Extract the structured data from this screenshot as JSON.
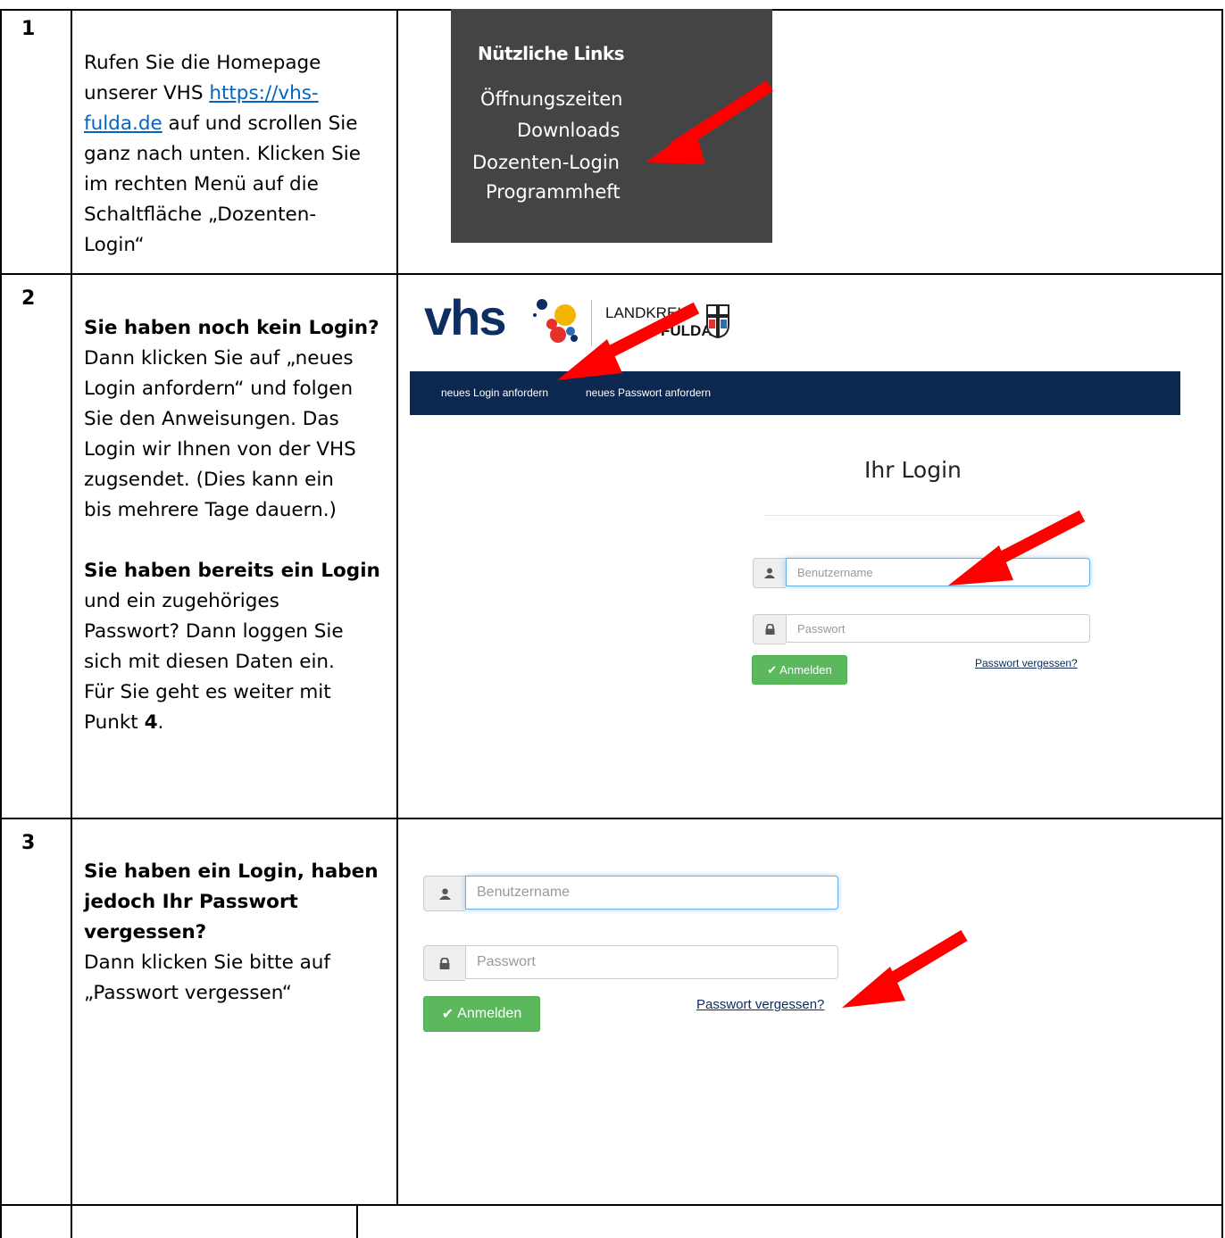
{
  "steps": [
    {
      "number": "1"
    },
    {
      "number": "2"
    },
    {
      "number": "3"
    }
  ],
  "step1": {
    "line1": "Rufen Sie die Homepage",
    "line2_pre": "unserer VHS ",
    "link_part1": "https://vhs-",
    "link_part2": "fulda.de",
    "line3_post": " auf und scrollen Sie",
    "line4": "ganz nach unten. Klicken Sie",
    "line5": "im rechten Menü auf die",
    "line6": "Schaltfläche „Dozenten-",
    "line7": "Login“",
    "panel_title": "Nützliche Links",
    "panel_links": [
      "Öffnungszeiten",
      "Downloads",
      "Dozenten-Login",
      "Programmheft"
    ]
  },
  "step2": {
    "bold1": "Sie haben noch kein Login?",
    "p1": [
      "Dann klicken Sie auf „neues",
      "Login anfordern“ und folgen",
      "Sie den Anweisungen. Das",
      "Login wir Ihnen von der VHS",
      "zugsendet. (Dies kann ein",
      "bis mehrere Tage dauern.)"
    ],
    "bold2": "Sie haben bereits ein Login",
    "p2": [
      "und ein zugehöriges",
      "Passwort? Dann loggen Sie",
      "sich mit diesen Daten ein.",
      "Für Sie geht es weiter mit"
    ],
    "p2_last_pre": "Punkt ",
    "p2_last_bold": "4",
    "p2_last_post": ".",
    "logo_text": "vhs",
    "landkreis": "LANDKREIS",
    "fulda": "FULDA",
    "nav": [
      "neues Login anfordern",
      "neues Passwort anfordern"
    ],
    "login_title": "Ihr Login",
    "username_placeholder": "Benutzername",
    "password_placeholder": "Passwort",
    "button": "Anmelden",
    "forgot": "Passwort vergessen?"
  },
  "step3": {
    "bold": [
      "Sie haben ein Login, haben",
      "jedoch Ihr Passwort",
      "vergessen?"
    ],
    "p": [
      "Dann klicken Sie bitte auf",
      "„Passwort vergessen“"
    ],
    "username_placeholder": "Benutzername",
    "password_placeholder": "Passwort",
    "button": "Anmelden",
    "forgot": "Passwort vergessen?"
  },
  "colors": {
    "navy": "#0d2850",
    "green": "#5cb85c",
    "arrow": "#ff0000",
    "panel": "#444444"
  }
}
